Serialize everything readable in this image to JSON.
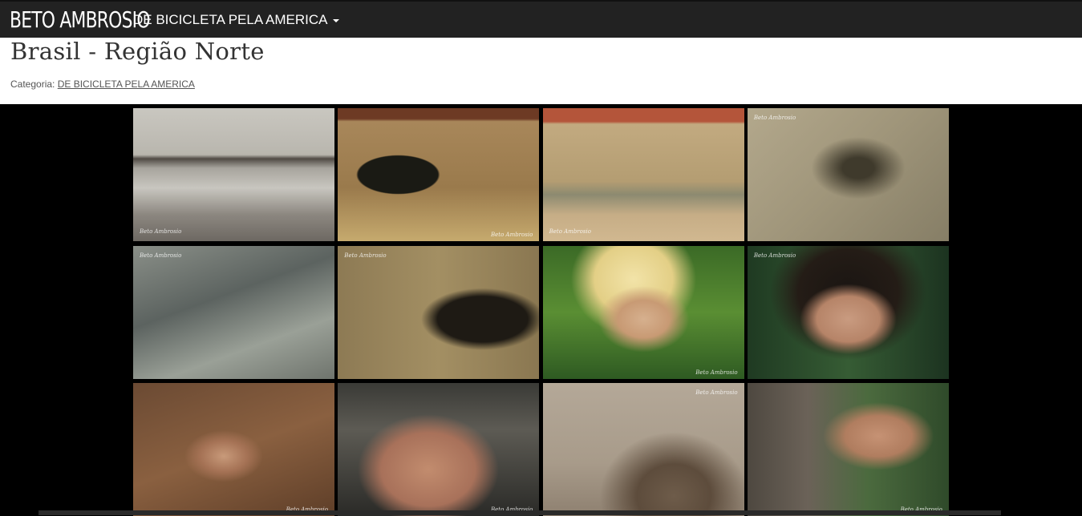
{
  "navbar": {
    "brand": "BETO AMBROSIO",
    "menu_label": "DE BICICLETA PELA AMERICA"
  },
  "page": {
    "title": "Brasil - Região Norte",
    "category_label": "Categoria:",
    "category_link": "DE BICICLETA PELA AMERICA"
  },
  "gallery": {
    "photos": [
      {
        "name": "beach-landscape"
      },
      {
        "name": "woman-at-window"
      },
      {
        "name": "family-at-mud-house"
      },
      {
        "name": "canoes-on-river"
      },
      {
        "name": "boy-in-mangrove"
      },
      {
        "name": "children-at-doorway"
      },
      {
        "name": "blond-boy-portrait"
      },
      {
        "name": "girl-with-wet-hair"
      },
      {
        "name": "child-in-river"
      },
      {
        "name": "family-selfie"
      },
      {
        "name": "child-on-sand"
      },
      {
        "name": "girl-at-fence"
      }
    ],
    "signature": "Beto Ambrosio"
  }
}
